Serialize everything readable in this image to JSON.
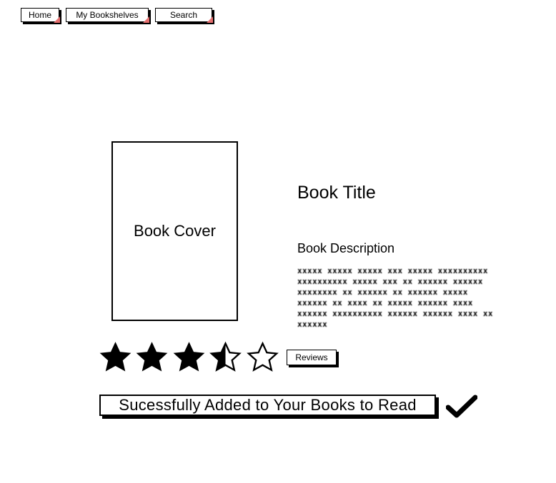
{
  "nav": {
    "home": "Home",
    "bookshelves": "My Bookshelves",
    "search": "Search",
    "accent_color": "#e56f6f"
  },
  "book": {
    "cover_label": "Book Cover",
    "title": "Book Title",
    "description_heading": "Book Description",
    "description_placeholder": "xxxxx xxxxx xxxxx xxx xxxxx xxxxxxxxxx xxxxxxxxxx xxxxx xxx xx xxxxxx xxxxxx xxxxxxxx xx xxxxxx xx xxxxxx xxxxx xxxxxx xx xxxx xx xxxxx xxxxxx xxxx xxxxxx xxxxxxxxxx xxxxxx xxxxxx xxxx xx xxxxxx"
  },
  "rating": {
    "value": 3.5,
    "max": 5
  },
  "reviews_label": "Reviews",
  "status": {
    "message": "Sucessfully Added to Your Books to Read",
    "icon": "checkmark-icon"
  }
}
